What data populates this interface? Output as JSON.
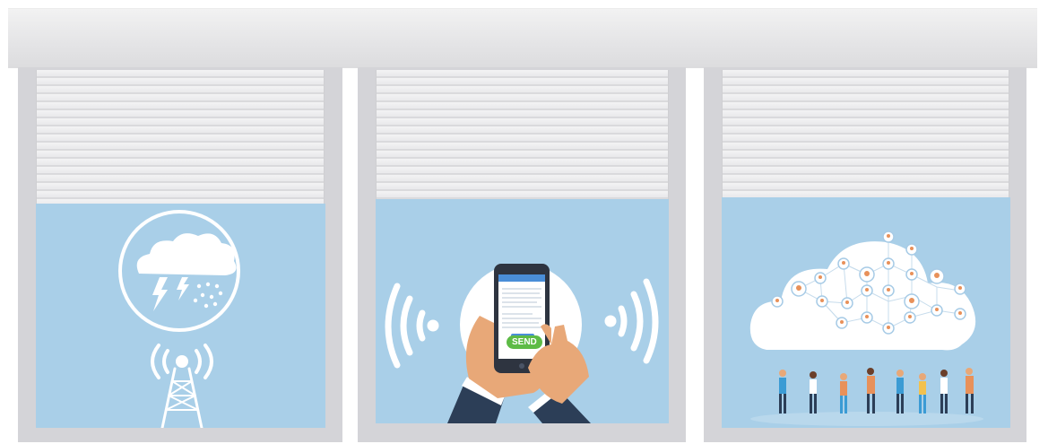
{
  "panels": [
    {
      "id": "weather",
      "icon": "storm-cloud-icon"
    },
    {
      "id": "messaging",
      "icon": "smartphone-icon",
      "send_label": "SEND",
      "screen_title": ""
    },
    {
      "id": "network",
      "icon": "people-network-cloud-icon"
    }
  ],
  "colors": {
    "scene_bg": "#a9cfe8",
    "frame": "#d4d4d8",
    "box": "#e4e4e6",
    "send_button": "#5dbb46"
  }
}
